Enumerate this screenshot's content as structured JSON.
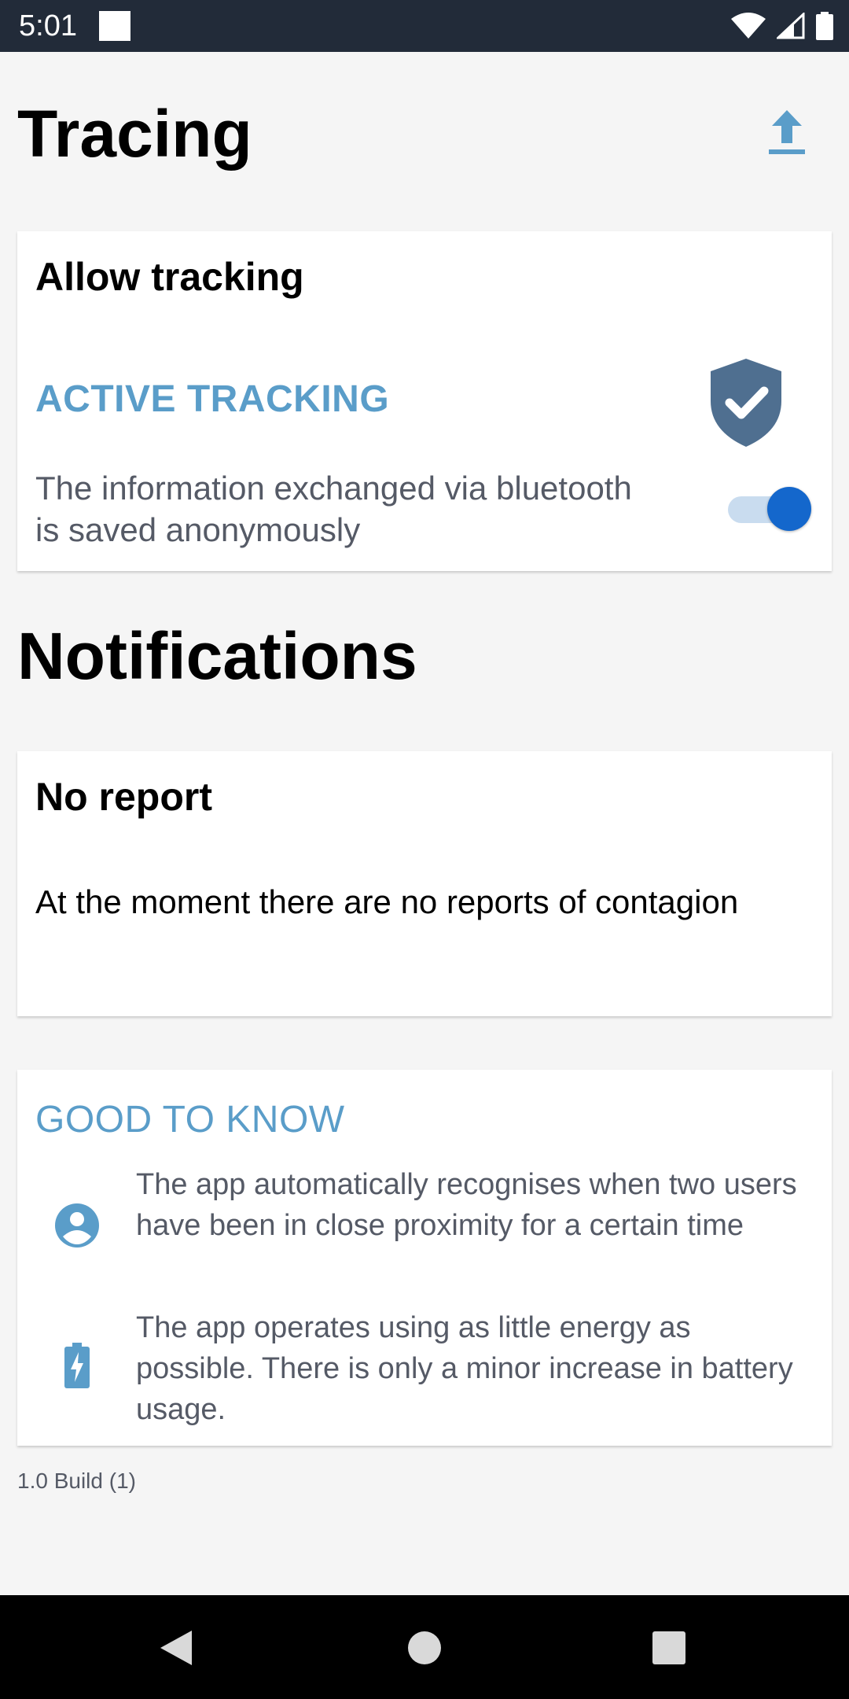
{
  "status_bar": {
    "time": "5:01",
    "icons": [
      "notification-square-icon",
      "wifi-icon",
      "cell-signal-icon",
      "battery-icon"
    ]
  },
  "header": {
    "title": "Tracing",
    "share_icon": "upload-icon"
  },
  "tracking_card": {
    "title": "Allow tracking",
    "status_label": "ACTIVE TRACKING",
    "status_icon": "shield-check-icon",
    "description": "The information exchanged via bluetooth is saved anonymously",
    "toggle_on": true
  },
  "notifications": {
    "title": "Notifications",
    "report_title": "No report",
    "report_description": "At the moment there are no reports of contagion"
  },
  "good_to_know": {
    "title": "GOOD TO KNOW",
    "items": [
      {
        "icon": "user-circle-icon",
        "text": "The app automatically recognises when two users have been in close proximity for a certain time"
      },
      {
        "icon": "battery-charging-icon",
        "text": "The app operates using as little energy as possible. There is only a minor increase in battery usage."
      }
    ]
  },
  "footer": {
    "version": "1.0 Build (1)"
  },
  "nav_bar": {
    "buttons": [
      "back-icon",
      "home-icon",
      "recents-icon"
    ]
  },
  "colors": {
    "accent": "#5a9dc9",
    "shield": "#4f6f90",
    "toggle": "#1467cc",
    "status_bar": "#222b39"
  }
}
